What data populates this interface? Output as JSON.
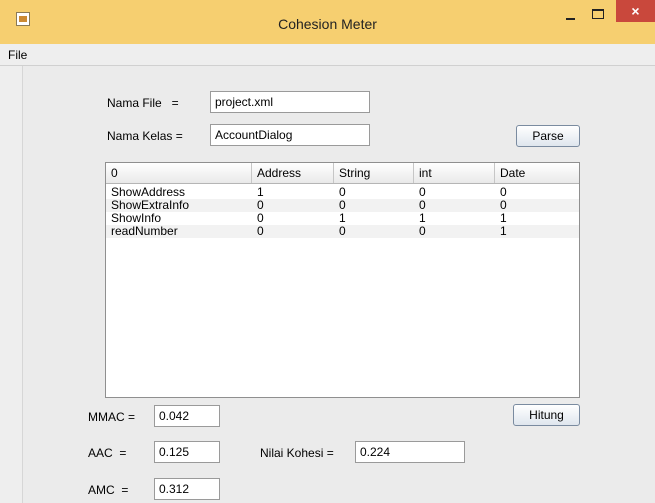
{
  "window": {
    "title": "Cohesion Meter",
    "close_glyph": "×"
  },
  "menu": {
    "items": [
      "File"
    ]
  },
  "form": {
    "nama_file_label": "Nama File   =",
    "nama_file_value": "project.xml",
    "nama_kelas_label": "Nama Kelas =",
    "nama_kelas_value": "AccountDialog",
    "parse_button": "Parse"
  },
  "table": {
    "columns": [
      "0",
      "Address",
      "String",
      "int",
      "Date"
    ],
    "rows": [
      [
        "ShowAddress",
        "1",
        "0",
        "0",
        "0"
      ],
      [
        "ShowExtraInfo",
        "0",
        "0",
        "0",
        "0"
      ],
      [
        "ShowInfo",
        "0",
        "1",
        "1",
        "1"
      ],
      [
        "readNumber",
        "0",
        "0",
        "0",
        "1"
      ]
    ]
  },
  "metrics": {
    "mmac_label": "MMAC =",
    "mmac_value": "0.042",
    "aac_label": "AAC  =",
    "aac_value": "0.125",
    "amc_label": "AMC  =",
    "amc_value": "0.312",
    "nilai_label": "Nilai Kohesi =",
    "nilai_value": "0.224",
    "hitung_button": "Hitung"
  },
  "icons": [
    "app-icon",
    "minimize-icon",
    "maximize-icon",
    "close-icon"
  ]
}
